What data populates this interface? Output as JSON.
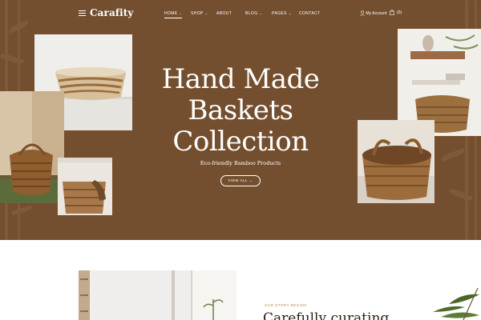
{
  "header": {
    "logo": "Carafity",
    "nav": [
      {
        "label": "HOME",
        "dropdown": true,
        "active": true
      },
      {
        "label": "SHOP",
        "dropdown": true,
        "active": false
      },
      {
        "label": "ABOUT",
        "dropdown": false,
        "active": false
      },
      {
        "label": "BLOG",
        "dropdown": true,
        "active": false
      },
      {
        "label": "PAGES",
        "dropdown": true,
        "active": false
      },
      {
        "label": "CONTACT",
        "dropdown": false,
        "active": false
      }
    ],
    "account_label": "My Account",
    "cart_count": "(0)"
  },
  "hero": {
    "title_lines": [
      "Hand Made",
      "Baskets",
      "Collection"
    ],
    "subtitle": "Eco-friendly Bamboo Products",
    "cta_label": "VIEW ALL",
    "cta_arrow": "→"
  },
  "story": {
    "eyebrow": "OUR STORY BEGINS",
    "heading": "Carefully curating"
  },
  "colors": {
    "hero_bg": "#744f2f",
    "accent": "#b7894f",
    "text_dark": "#2b2118"
  }
}
